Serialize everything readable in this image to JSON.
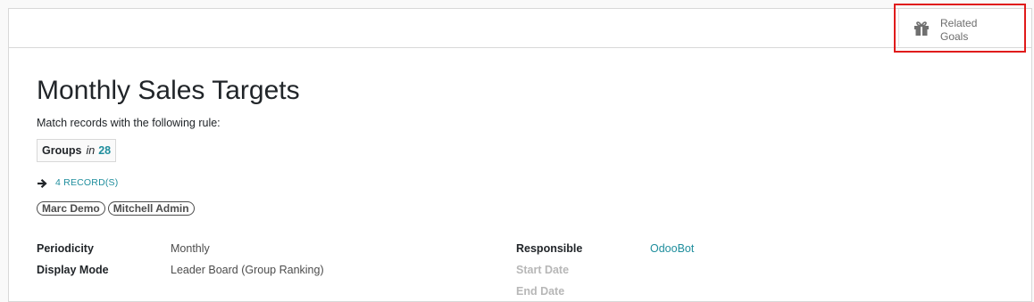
{
  "buttons": {
    "related_goals_line1": "Related",
    "related_goals_line2": "Goals"
  },
  "record": {
    "title": "Monthly Sales Targets",
    "rule_label": "Match records with the following rule:",
    "domain": {
      "field": "Groups",
      "operator": "in",
      "value": "28"
    },
    "records_link": "4 RECORD(S)",
    "tags": [
      "Marc Demo",
      "Mitchell Admin"
    ]
  },
  "fields_left": [
    {
      "label": "Periodicity",
      "value": "Monthly"
    },
    {
      "label": "Display Mode",
      "value": "Leader Board (Group Ranking)"
    }
  ],
  "fields_right": [
    {
      "label": "Responsible",
      "value": "OdooBot"
    },
    {
      "label": "Start Date",
      "value": ""
    },
    {
      "label": "End Date",
      "value": ""
    }
  ],
  "colors": {
    "accent": "#1f8e9d",
    "highlight_border": "#e01b1b"
  },
  "icons": {
    "related_goals": "gift-icon",
    "records_arrow": "arrow-right-icon"
  }
}
